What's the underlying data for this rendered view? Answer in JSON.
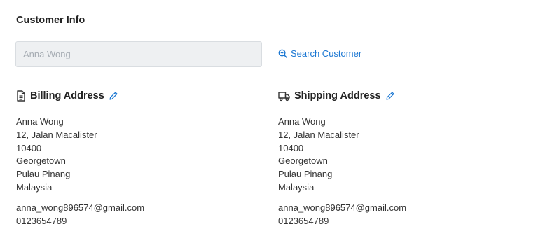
{
  "customer_info": {
    "title": "Customer Info",
    "search_input_placeholder": "Anna Wong",
    "search_link_label": "Search Customer",
    "accent_color": "#1976d2"
  },
  "billing": {
    "title": "Billing Address",
    "icon": "document-icon",
    "name": "Anna Wong",
    "street": "12, Jalan Macalister",
    "postcode": "10400",
    "city": "Georgetown",
    "state": "Pulau Pinang",
    "country": "Malaysia",
    "email": "anna_wong896574@gmail.com",
    "phone": "0123654789"
  },
  "shipping": {
    "title": "Shipping Address",
    "icon": "truck-icon",
    "name": "Anna Wong",
    "street": "12, Jalan Macalister",
    "postcode": "10400",
    "city": "Georgetown",
    "state": "Pulau Pinang",
    "country": "Malaysia",
    "email": "anna_wong896574@gmail.com",
    "phone": "0123654789"
  }
}
